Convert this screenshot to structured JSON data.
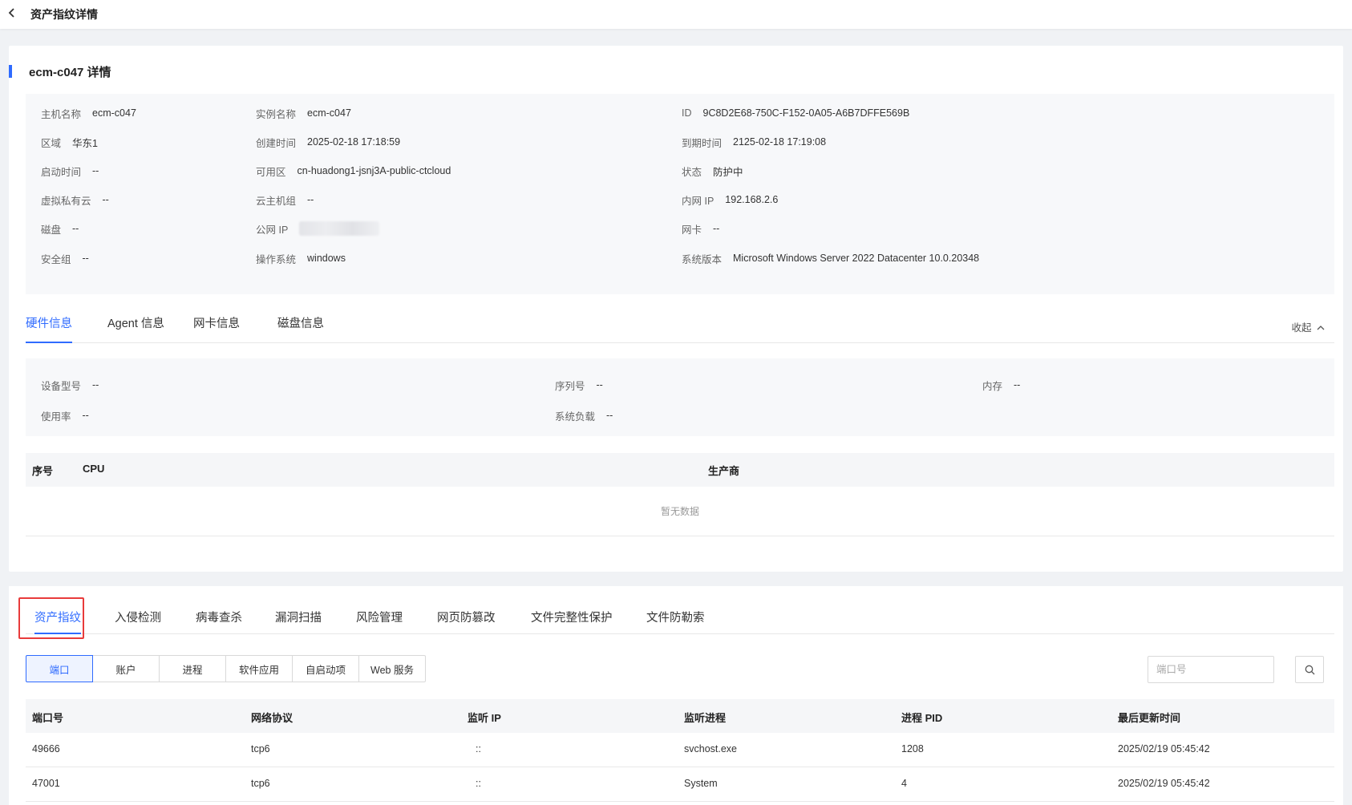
{
  "header": {
    "back_icon": "chevron-left-icon",
    "title": "资产指纹详情"
  },
  "detail": {
    "title": "ecm-c047 详情",
    "fields": {
      "hostname": {
        "label": "主机名称",
        "value": "ecm-c047"
      },
      "instance": {
        "label": "实例名称",
        "value": "ecm-c047"
      },
      "id": {
        "label": "ID",
        "value": "9C8D2E68-750C-F152-0A05-A6B7DFFE569B"
      },
      "region": {
        "label": "区域",
        "value": "华东1"
      },
      "created": {
        "label": "创建时间",
        "value": "2025-02-18 17:18:59"
      },
      "expire": {
        "label": "到期时间",
        "value": "2125-02-18 17:19:08"
      },
      "boot": {
        "label": "启动时间",
        "value": "--"
      },
      "zone": {
        "label": "可用区",
        "value": "cn-huadong1-jsnj3A-public-ctcloud"
      },
      "status": {
        "label": "状态",
        "value": "防护中"
      },
      "vpc": {
        "label": "虚拟私有云",
        "value": "--"
      },
      "host_group": {
        "label": "云主机组",
        "value": "--"
      },
      "private_ip": {
        "label": "内网 IP",
        "value": "192.168.2.6"
      },
      "disk": {
        "label": "磁盘",
        "value": "--"
      },
      "public_ip": {
        "label": "公网 IP"
      },
      "nic": {
        "label": "网卡",
        "value": "--"
      },
      "sec_group": {
        "label": "安全组",
        "value": "--"
      },
      "os": {
        "label": "操作系统",
        "value": "windows"
      },
      "os_version": {
        "label": "系统版本",
        "value": "Microsoft Windows Server 2022 Datacenter 10.0.20348"
      }
    }
  },
  "info_tabs": {
    "items": [
      "硬件信息",
      "Agent 信息",
      "网卡信息",
      "磁盘信息"
    ],
    "active": 0,
    "collapse_label": "收起",
    "collapse_icon": "chevron-up-icon"
  },
  "hardware": {
    "model": {
      "label": "设备型号",
      "value": "--"
    },
    "serial": {
      "label": "序列号",
      "value": "--"
    },
    "memory": {
      "label": "内存",
      "value": "--"
    },
    "usage": {
      "label": "使用率",
      "value": "--"
    },
    "load": {
      "label": "系统负载",
      "value": "--"
    }
  },
  "cpu_table": {
    "columns": [
      "序号",
      "CPU",
      "生产商"
    ],
    "empty_text": "暂无数据"
  },
  "main_tabs": {
    "items": [
      "资产指纹",
      "入侵检测",
      "病毒查杀",
      "漏洞扫描",
      "风险管理",
      "网页防篡改",
      "文件完整性保护",
      "文件防勒索"
    ],
    "active": 0
  },
  "sub_tabs": {
    "items": [
      "端口",
      "账户",
      "进程",
      "软件应用",
      "自启动项",
      "Web 服务"
    ],
    "active": 0
  },
  "search": {
    "placeholder": "端口号",
    "icon": "search-icon"
  },
  "port_table": {
    "columns": [
      "端口号",
      "网络协议",
      "监听 IP",
      "监听进程",
      "进程 PID",
      "最后更新时间"
    ],
    "rows": [
      [
        "49666",
        "tcp6",
        "::",
        "svchost.exe",
        "1208",
        "2025/02/19 05:45:42"
      ],
      [
        "47001",
        "tcp6",
        "::",
        "System",
        "4",
        "2025/02/19 05:45:42"
      ]
    ]
  },
  "colors": {
    "accent": "#2f6bff",
    "highlight": "#e83b3b"
  }
}
